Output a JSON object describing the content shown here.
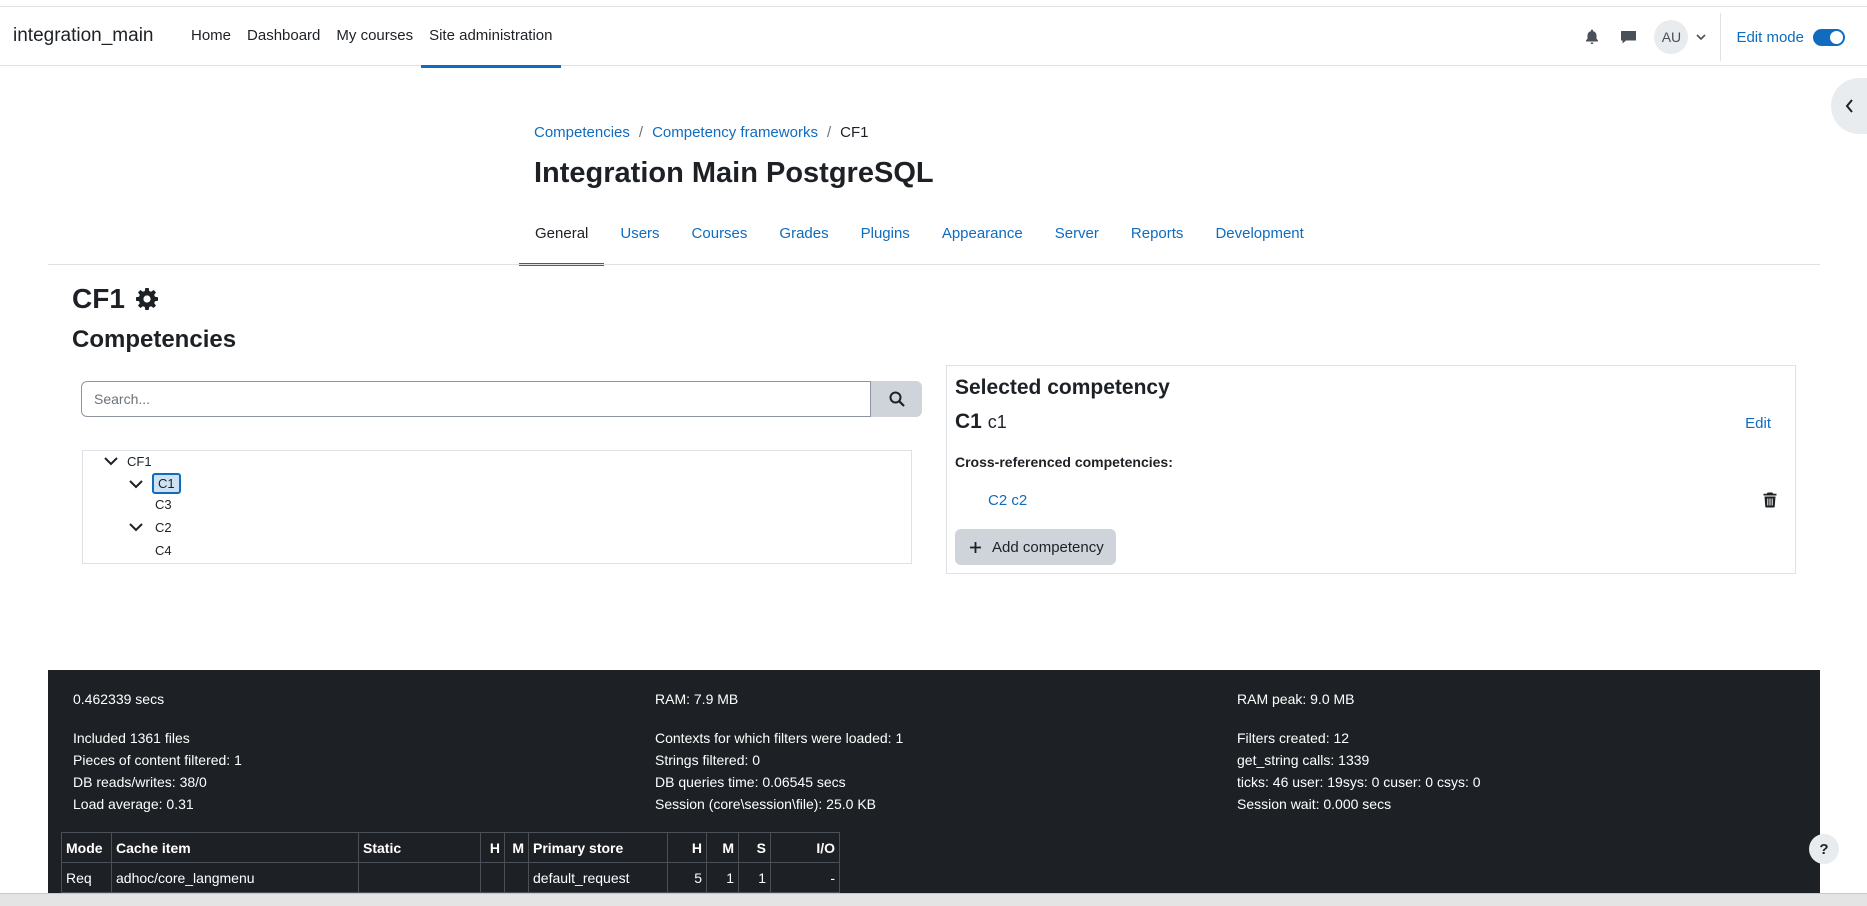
{
  "header": {
    "site_name": "integration_main",
    "nav": [
      "Home",
      "Dashboard",
      "My courses",
      "Site administration"
    ],
    "active_nav": "Site administration",
    "avatar_initials": "AU",
    "edit_mode_label": "Edit mode",
    "edit_mode_on": true
  },
  "breadcrumb": [
    "Competencies",
    "Competency frameworks",
    "CF1"
  ],
  "page_title": "Integration Main PostgreSQL",
  "secondary_nav": [
    "General",
    "Users",
    "Courses",
    "Grades",
    "Plugins",
    "Appearance",
    "Server",
    "Reports",
    "Development"
  ],
  "framework": {
    "name": "CF1",
    "heading": "Competencies",
    "search_placeholder": "Search...",
    "tree": {
      "root": "CF1",
      "c1": "C1",
      "c3": "C3",
      "c2": "C2",
      "c4": "C4"
    }
  },
  "selected": {
    "title": "Selected competency",
    "idnumber": "C1",
    "shortname": "c1",
    "edit_label": "Edit",
    "xref_label": "Cross-referenced competencies:",
    "xref_item": "C2 c2",
    "add_label": "Add competency"
  },
  "perf": {
    "col1": [
      "0.462339 secs",
      "Included 1361 files",
      "Pieces of content filtered: 1",
      "DB reads/writes: 38/0",
      "Load average: 0.31"
    ],
    "col2": [
      "RAM: 7.9 MB",
      "Contexts for which filters were loaded: 1",
      "Strings filtered: 0",
      "DB queries time: 0.06545 secs",
      "Session (core\\session\\file): 25.0 KB"
    ],
    "col3": [
      "RAM peak: 9.0 MB",
      "Filters created: 12",
      "get_string calls: 1339",
      "ticks: 46 user: 19sys: 0 cuser: 0 csys: 0",
      "Session wait: 0.000 secs"
    ]
  },
  "cache_table": {
    "headers": [
      "Mode",
      "Cache item",
      "Static",
      "H",
      "M",
      "Primary store",
      "H",
      "M",
      "S",
      "I/O"
    ],
    "row": [
      "Req",
      "adhoc/core_langmenu",
      "",
      "",
      "",
      "default_request",
      "5",
      "1",
      "1",
      "-"
    ]
  },
  "help_label": "?",
  "colors": {
    "primary": "#0f6cbf",
    "footer_bg": "#1d2125"
  }
}
